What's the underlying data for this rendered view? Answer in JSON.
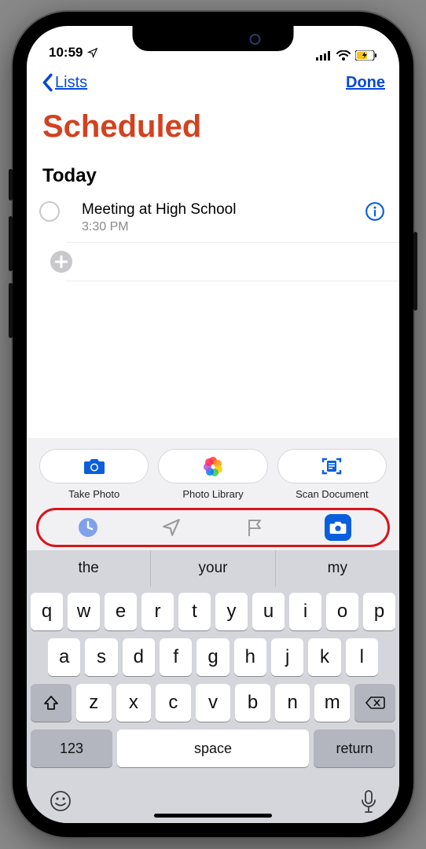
{
  "status": {
    "time": "10:59"
  },
  "nav": {
    "back": "Lists",
    "done": "Done"
  },
  "page": {
    "title": "Scheduled",
    "section": "Today"
  },
  "reminder": {
    "title": "Meeting at High School",
    "time": "3:30 PM"
  },
  "attach": {
    "take_photo": "Take Photo",
    "photo_library": "Photo Library",
    "scan_document": "Scan Document"
  },
  "suggest": {
    "a": "the",
    "b": "your",
    "c": "my"
  },
  "keys": {
    "r1": [
      "q",
      "w",
      "e",
      "r",
      "t",
      "y",
      "u",
      "i",
      "o",
      "p"
    ],
    "r2": [
      "a",
      "s",
      "d",
      "f",
      "g",
      "h",
      "j",
      "k",
      "l"
    ],
    "r3": [
      "z",
      "x",
      "c",
      "v",
      "b",
      "n",
      "m"
    ],
    "k123": "123",
    "space": "space",
    "return": "return"
  }
}
